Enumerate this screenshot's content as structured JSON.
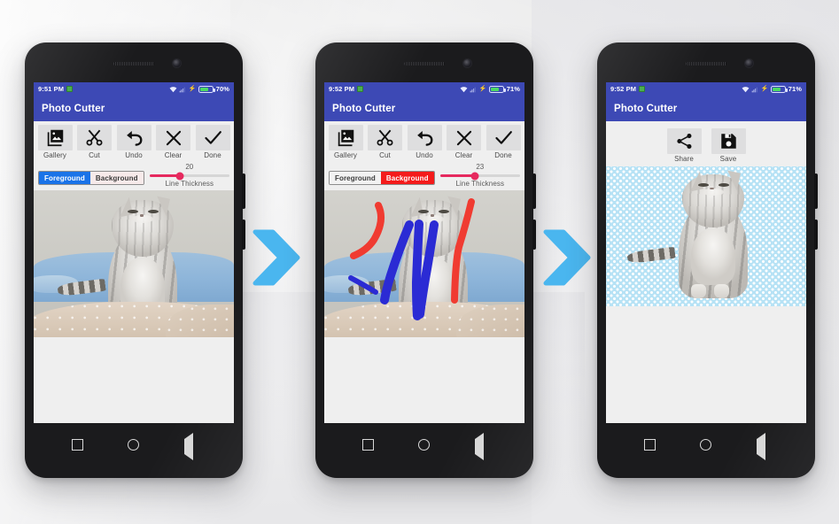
{
  "app": {
    "name": "Photo Cutter"
  },
  "background": {
    "color": "#f1f1f3"
  },
  "theme": {
    "appbar": "#3d49b5",
    "statusbar": "#3d49b5",
    "toolpanel": "#efefef",
    "foreground_selected": "#1a73e8",
    "background_selected": "#f41b1b",
    "slider": "#e6295e",
    "arrow": "#4ab6ef",
    "alpha_pattern": "#b6e2f5",
    "stroke_foreground": "#2b2bd4",
    "stroke_background": "#f03b31"
  },
  "arrows": [
    {
      "name": "step-1-to-2",
      "glyph": "chevron-right"
    },
    {
      "name": "step-2-to-3",
      "glyph": "chevron-right"
    }
  ],
  "phones": [
    {
      "id": "phone-1",
      "statusbar": {
        "clock": "9:51 PM",
        "notification_icon": "sim-card-icon",
        "wifi_icon": "wifi-icon",
        "signal_icon": "signal-bars-icon",
        "charging_icon": "⚡",
        "battery_percent": "70%",
        "battery_level": 70
      },
      "appbar": {
        "title": "Photo Cutter"
      },
      "tools": [
        {
          "icon": "gallery-icon",
          "label": "Gallery"
        },
        {
          "icon": "scissors-icon",
          "label": "Cut"
        },
        {
          "icon": "undo-icon",
          "label": "Undo"
        },
        {
          "icon": "close-x-icon",
          "label": "Clear"
        },
        {
          "icon": "check-icon",
          "label": "Done"
        }
      ],
      "segmented": {
        "options": [
          "Foreground",
          "Background"
        ],
        "selected": "Foreground",
        "selected_index": 0
      },
      "slider": {
        "value": "20",
        "caption": "Line Thickness",
        "percent": 38
      },
      "canvas": {
        "content": "cat-photo",
        "strokes": []
      },
      "navbar": {
        "recents_icon": "square-icon",
        "home_icon": "circle-icon",
        "back_icon": "triangle-back-icon"
      }
    },
    {
      "id": "phone-2",
      "statusbar": {
        "clock": "9:52 PM",
        "notification_icon": "sim-card-icon",
        "wifi_icon": "wifi-icon",
        "signal_icon": "signal-bars-icon",
        "charging_icon": "⚡",
        "battery_percent": "71%",
        "battery_level": 71
      },
      "appbar": {
        "title": "Photo Cutter"
      },
      "tools": [
        {
          "icon": "gallery-icon",
          "label": "Gallery"
        },
        {
          "icon": "scissors-icon",
          "label": "Cut"
        },
        {
          "icon": "undo-icon",
          "label": "Undo"
        },
        {
          "icon": "close-x-icon",
          "label": "Clear"
        },
        {
          "icon": "check-icon",
          "label": "Done"
        }
      ],
      "segmented": {
        "options": [
          "Foreground",
          "Background"
        ],
        "selected": "Background",
        "selected_index": 1
      },
      "slider": {
        "value": "23",
        "caption": "Line Thickness",
        "percent": 44
      },
      "canvas": {
        "content": "cat-photo-with-markup",
        "strokes": [
          {
            "type": "background",
            "color": "#f03b31",
            "name": "red-stroke-left"
          },
          {
            "type": "background",
            "color": "#f03b31",
            "name": "red-stroke-right"
          },
          {
            "type": "foreground",
            "color": "#2b2bd4",
            "name": "blue-stroke-left"
          },
          {
            "type": "foreground",
            "color": "#2b2bd4",
            "name": "blue-stroke-mid"
          },
          {
            "type": "foreground",
            "color": "#2b2bd4",
            "name": "blue-stroke-right"
          }
        ]
      },
      "navbar": {
        "recents_icon": "square-icon",
        "home_icon": "circle-icon",
        "back_icon": "triangle-back-icon"
      }
    },
    {
      "id": "phone-3",
      "statusbar": {
        "clock": "9:52 PM",
        "notification_icon": "sim-card-icon",
        "wifi_icon": "wifi-icon",
        "signal_icon": "signal-bars-icon",
        "charging_icon": "⚡",
        "battery_percent": "71%",
        "battery_level": 71
      },
      "appbar": {
        "title": "Photo Cutter"
      },
      "tools": [
        {
          "icon": "share-icon",
          "label": "Share"
        },
        {
          "icon": "save-floppy-icon",
          "label": "Save"
        }
      ],
      "canvas": {
        "content": "cut-out-cat-on-transparency"
      },
      "navbar": {
        "recents_icon": "square-icon",
        "home_icon": "circle-icon",
        "back_icon": "triangle-back-icon"
      }
    }
  ]
}
